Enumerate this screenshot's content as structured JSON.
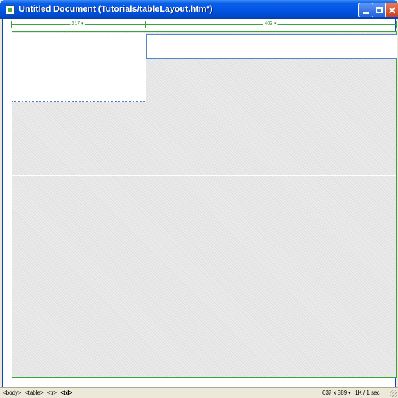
{
  "window": {
    "title": "Untitled Document (Tutorials/tableLayout.htm*)"
  },
  "ruler": {
    "left_width": "217 ▾",
    "right_width": "403 ▾"
  },
  "statusbar": {
    "tags": [
      "<body>",
      "<table>",
      "<tr>",
      "<td>"
    ],
    "window_size": "637 x 589",
    "size_menu_arrow": "▾",
    "download_time": "1K / 1 sec"
  },
  "icons": {
    "app": "dreamweaver-document-icon",
    "minimize": "minimize-icon",
    "maximize": "maximize-icon",
    "close": "close-icon"
  },
  "colors": {
    "layout_outline": "#3aa43a",
    "cell_outline": "#4f88c8",
    "titlebar": "#0054e3",
    "close_button": "#c5421f"
  }
}
